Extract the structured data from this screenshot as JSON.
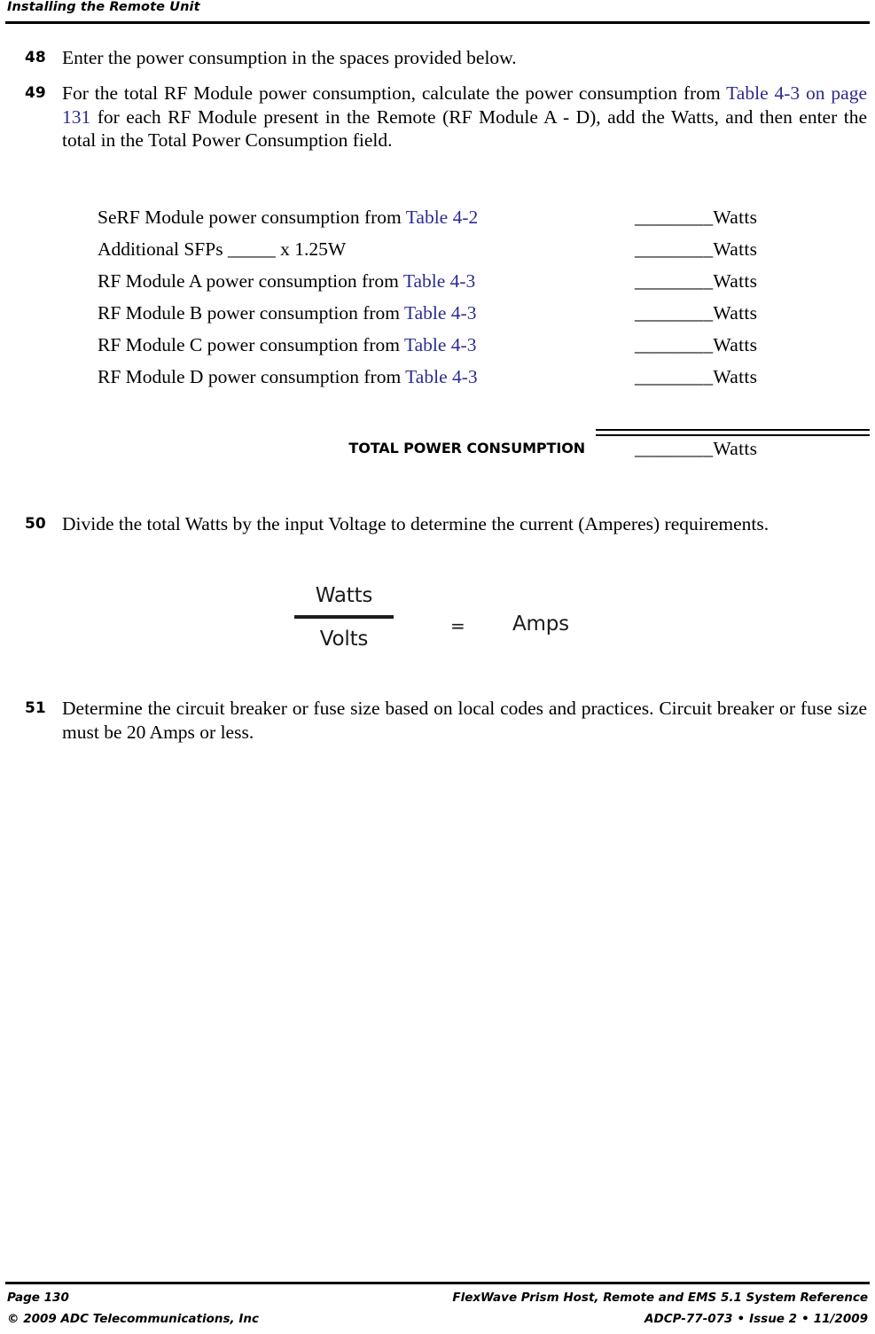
{
  "header": {
    "title": "Installing the Remote Unit"
  },
  "steps": [
    {
      "number": "48",
      "text": "Enter the power consumption in the spaces provided below."
    },
    {
      "number": "49",
      "text_before": "For the total RF Module power consumption, calculate the power consumption from ",
      "link": "Table 4-3 on page 131",
      "text_after": " for each RF Module present in the Remote (RF Module A - D), add the Watts, and then enter the total in the Total Power Consumption field."
    },
    {
      "number": "50",
      "text": "Divide the total Watts by the input Voltage to determine the current (Amperes) requirements."
    },
    {
      "number": "51",
      "text": "Determine the circuit breaker or fuse size based on local codes and practices. Circuit breaker or fuse size must be 20 Amps or less."
    }
  ],
  "worksheet": {
    "rows": [
      {
        "label_before": "SeRF Module power consumption from ",
        "link": "Table 4-2",
        "label_after": "",
        "value": "________Watts"
      },
      {
        "label_before": "Additional SFPs _____ x 1.25W",
        "link": "",
        "label_after": "",
        "value": "________Watts"
      },
      {
        "label_before": "RF Module A power consumption from ",
        "link": "Table 4-3",
        "label_after": "",
        "value": "________Watts"
      },
      {
        "label_before": "RF Module B power consumption from ",
        "link": "Table 4-3",
        "label_after": "",
        "value": "________Watts"
      },
      {
        "label_before": "RF Module C power consumption from ",
        "link": "Table 4-3",
        "label_after": "",
        "value": "________Watts"
      },
      {
        "label_before": "RF Module D power consumption from ",
        "link": "Table 4-3",
        "label_after": "",
        "value": "________Watts"
      }
    ],
    "total": {
      "label": "TOTAL POWER CONSUMPTION",
      "value": "________Watts"
    }
  },
  "formula": {
    "numerator": "Watts",
    "denominator": "Volts",
    "equals": "=",
    "result": "Amps"
  },
  "footer": {
    "page": "Page 130",
    "copyright": "©  2009 ADC Telecommunications, Inc",
    "product": "FlexWave Prism Host, Remote and EMS 5.1 System Reference",
    "doc_number": "ADCP-77-073",
    "issue": "Issue 2",
    "date": "11/2009",
    "separator": "•"
  },
  "colors": {
    "link": "#2b2b8f",
    "text": "#000000",
    "background": "#ffffff"
  }
}
